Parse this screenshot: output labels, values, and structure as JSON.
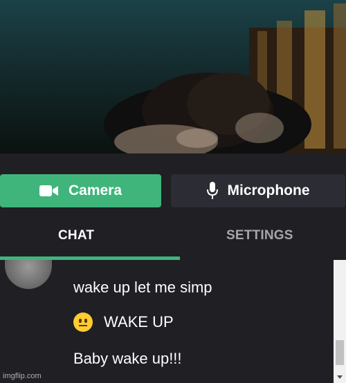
{
  "video": {
    "description_icon": "webcam-feed"
  },
  "controls": {
    "camera_label": "Camera",
    "camera_icon": "video-camera-icon",
    "microphone_label": "Microphone",
    "microphone_icon": "microphone-icon",
    "accent_color": "#3fb57b"
  },
  "tabs": [
    {
      "label": "CHAT",
      "active": true
    },
    {
      "label": "SETTINGS",
      "active": false
    }
  ],
  "chat": {
    "messages": [
      {
        "text": "wake up let me simp"
      },
      {
        "emoji": "neutral-face",
        "text": "WAKE UP"
      },
      {
        "text": "Baby wake up!!!"
      }
    ]
  },
  "watermark": "imgflip.com"
}
